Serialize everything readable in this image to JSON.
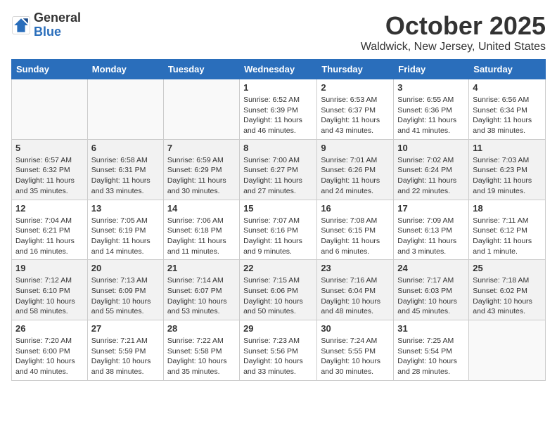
{
  "header": {
    "logo_general": "General",
    "logo_blue": "Blue",
    "title": "October 2025",
    "subtitle": "Waldwick, New Jersey, United States"
  },
  "days_of_week": [
    "Sunday",
    "Monday",
    "Tuesday",
    "Wednesday",
    "Thursday",
    "Friday",
    "Saturday"
  ],
  "weeks": [
    [
      {
        "day": "",
        "info": ""
      },
      {
        "day": "",
        "info": ""
      },
      {
        "day": "",
        "info": ""
      },
      {
        "day": "1",
        "info": "Sunrise: 6:52 AM\nSunset: 6:39 PM\nDaylight: 11 hours and 46 minutes."
      },
      {
        "day": "2",
        "info": "Sunrise: 6:53 AM\nSunset: 6:37 PM\nDaylight: 11 hours and 43 minutes."
      },
      {
        "day": "3",
        "info": "Sunrise: 6:55 AM\nSunset: 6:36 PM\nDaylight: 11 hours and 41 minutes."
      },
      {
        "day": "4",
        "info": "Sunrise: 6:56 AM\nSunset: 6:34 PM\nDaylight: 11 hours and 38 minutes."
      }
    ],
    [
      {
        "day": "5",
        "info": "Sunrise: 6:57 AM\nSunset: 6:32 PM\nDaylight: 11 hours and 35 minutes."
      },
      {
        "day": "6",
        "info": "Sunrise: 6:58 AM\nSunset: 6:31 PM\nDaylight: 11 hours and 33 minutes."
      },
      {
        "day": "7",
        "info": "Sunrise: 6:59 AM\nSunset: 6:29 PM\nDaylight: 11 hours and 30 minutes."
      },
      {
        "day": "8",
        "info": "Sunrise: 7:00 AM\nSunset: 6:27 PM\nDaylight: 11 hours and 27 minutes."
      },
      {
        "day": "9",
        "info": "Sunrise: 7:01 AM\nSunset: 6:26 PM\nDaylight: 11 hours and 24 minutes."
      },
      {
        "day": "10",
        "info": "Sunrise: 7:02 AM\nSunset: 6:24 PM\nDaylight: 11 hours and 22 minutes."
      },
      {
        "day": "11",
        "info": "Sunrise: 7:03 AM\nSunset: 6:23 PM\nDaylight: 11 hours and 19 minutes."
      }
    ],
    [
      {
        "day": "12",
        "info": "Sunrise: 7:04 AM\nSunset: 6:21 PM\nDaylight: 11 hours and 16 minutes."
      },
      {
        "day": "13",
        "info": "Sunrise: 7:05 AM\nSunset: 6:19 PM\nDaylight: 11 hours and 14 minutes."
      },
      {
        "day": "14",
        "info": "Sunrise: 7:06 AM\nSunset: 6:18 PM\nDaylight: 11 hours and 11 minutes."
      },
      {
        "day": "15",
        "info": "Sunrise: 7:07 AM\nSunset: 6:16 PM\nDaylight: 11 hours and 9 minutes."
      },
      {
        "day": "16",
        "info": "Sunrise: 7:08 AM\nSunset: 6:15 PM\nDaylight: 11 hours and 6 minutes."
      },
      {
        "day": "17",
        "info": "Sunrise: 7:09 AM\nSunset: 6:13 PM\nDaylight: 11 hours and 3 minutes."
      },
      {
        "day": "18",
        "info": "Sunrise: 7:11 AM\nSunset: 6:12 PM\nDaylight: 11 hours and 1 minute."
      }
    ],
    [
      {
        "day": "19",
        "info": "Sunrise: 7:12 AM\nSunset: 6:10 PM\nDaylight: 10 hours and 58 minutes."
      },
      {
        "day": "20",
        "info": "Sunrise: 7:13 AM\nSunset: 6:09 PM\nDaylight: 10 hours and 55 minutes."
      },
      {
        "day": "21",
        "info": "Sunrise: 7:14 AM\nSunset: 6:07 PM\nDaylight: 10 hours and 53 minutes."
      },
      {
        "day": "22",
        "info": "Sunrise: 7:15 AM\nSunset: 6:06 PM\nDaylight: 10 hours and 50 minutes."
      },
      {
        "day": "23",
        "info": "Sunrise: 7:16 AM\nSunset: 6:04 PM\nDaylight: 10 hours and 48 minutes."
      },
      {
        "day": "24",
        "info": "Sunrise: 7:17 AM\nSunset: 6:03 PM\nDaylight: 10 hours and 45 minutes."
      },
      {
        "day": "25",
        "info": "Sunrise: 7:18 AM\nSunset: 6:02 PM\nDaylight: 10 hours and 43 minutes."
      }
    ],
    [
      {
        "day": "26",
        "info": "Sunrise: 7:20 AM\nSunset: 6:00 PM\nDaylight: 10 hours and 40 minutes."
      },
      {
        "day": "27",
        "info": "Sunrise: 7:21 AM\nSunset: 5:59 PM\nDaylight: 10 hours and 38 minutes."
      },
      {
        "day": "28",
        "info": "Sunrise: 7:22 AM\nSunset: 5:58 PM\nDaylight: 10 hours and 35 minutes."
      },
      {
        "day": "29",
        "info": "Sunrise: 7:23 AM\nSunset: 5:56 PM\nDaylight: 10 hours and 33 minutes."
      },
      {
        "day": "30",
        "info": "Sunrise: 7:24 AM\nSunset: 5:55 PM\nDaylight: 10 hours and 30 minutes."
      },
      {
        "day": "31",
        "info": "Sunrise: 7:25 AM\nSunset: 5:54 PM\nDaylight: 10 hours and 28 minutes."
      },
      {
        "day": "",
        "info": ""
      }
    ]
  ]
}
